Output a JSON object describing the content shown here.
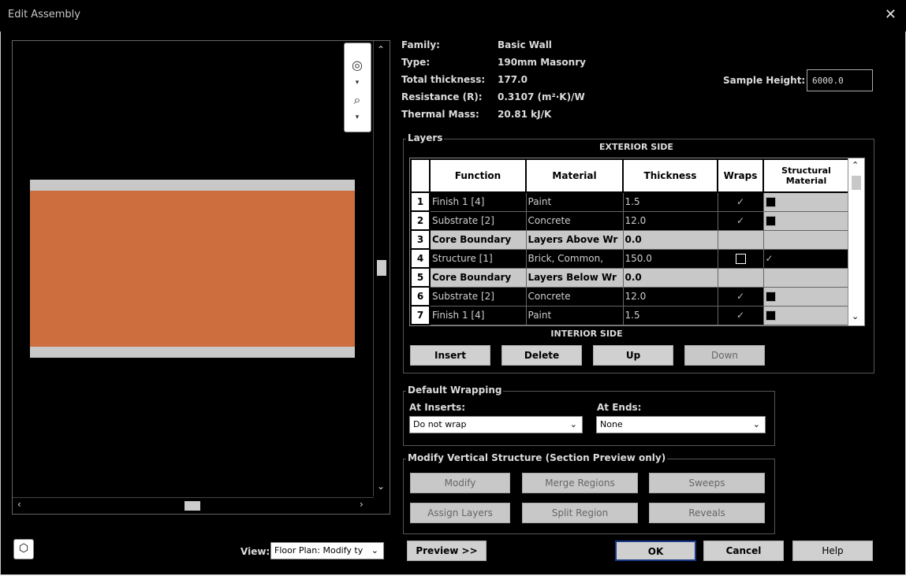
{
  "window": {
    "title": "Edit Assembly",
    "close_icon": "✕"
  },
  "info": {
    "family_label": "Family:",
    "family_value": "Basic Wall",
    "type_label": "Type:",
    "type_value": "190mm Masonry",
    "thickness_label": "Total thickness:",
    "thickness_value": "177.0",
    "resistance_label": "Resistance (R):",
    "resistance_value": "0.3107 (m²·K)/W",
    "mass_label": "Thermal Mass:",
    "mass_value": "20.81 kJ/K",
    "sample_height_label": "Sample Height:",
    "sample_height_value": "6000.0"
  },
  "layers": {
    "group_label": "Layers",
    "exterior_label": "EXTERIOR SIDE",
    "interior_label": "INTERIOR SIDE",
    "columns": [
      "",
      "Function",
      "Material",
      "Thickness",
      "Wraps",
      "Structural Material"
    ],
    "rows": [
      {
        "num": "1",
        "function": "Finish 1 [4]",
        "material": "Paint",
        "thickness": "1.5",
        "wraps": "✓",
        "structural": "box",
        "style": "dark"
      },
      {
        "num": "2",
        "function": "Substrate [2]",
        "material": "Concrete",
        "thickness": "12.0",
        "wraps": "✓",
        "structural": "box",
        "style": "dark"
      },
      {
        "num": "3",
        "function": "Core Boundary",
        "material": "Layers Above Wr",
        "thickness": "0.0",
        "wraps": "",
        "structural": "",
        "style": "core"
      },
      {
        "num": "4",
        "function": "Structure [1]",
        "material": "Brick, Common,",
        "thickness": "150.0",
        "wraps": "box",
        "structural": "✓",
        "style": "sel"
      },
      {
        "num": "5",
        "function": "Core Boundary",
        "material": "Layers Below Wr",
        "thickness": "0.0",
        "wraps": "",
        "structural": "",
        "style": "core"
      },
      {
        "num": "6",
        "function": "Substrate [2]",
        "material": "Concrete",
        "thickness": "12.0",
        "wraps": "✓",
        "structural": "box",
        "style": "dark"
      },
      {
        "num": "7",
        "function": "Finish 1 [4]",
        "material": "Paint",
        "thickness": "1.5",
        "wraps": "✓",
        "structural": "box",
        "style": "dark"
      }
    ],
    "buttons": {
      "insert": "Insert",
      "delete": "Delete",
      "up": "Up",
      "down": "Down"
    },
    "ellipsis": "…"
  },
  "wrapping": {
    "group_label": "Default Wrapping",
    "inserts_label": "At Inserts:",
    "inserts_value": "Do not wrap",
    "ends_label": "At Ends:",
    "ends_value": "None"
  },
  "vertical": {
    "group_label": "Modify Vertical Structure (Section Preview only)",
    "modify": "Modify",
    "merge": "Merge Regions",
    "sweeps": "Sweeps",
    "assign": "Assign Layers",
    "split": "Split Region",
    "reveals": "Reveals"
  },
  "footer": {
    "view_label": "View:",
    "view_value": "Floor Plan: Modify ty",
    "preview": "Preview >>",
    "ok": "OK",
    "cancel": "Cancel",
    "help": "Help"
  },
  "colors": {
    "core_material": "#cc6e3e",
    "finish_layer": "#c8c8c8",
    "background": "#000000"
  }
}
